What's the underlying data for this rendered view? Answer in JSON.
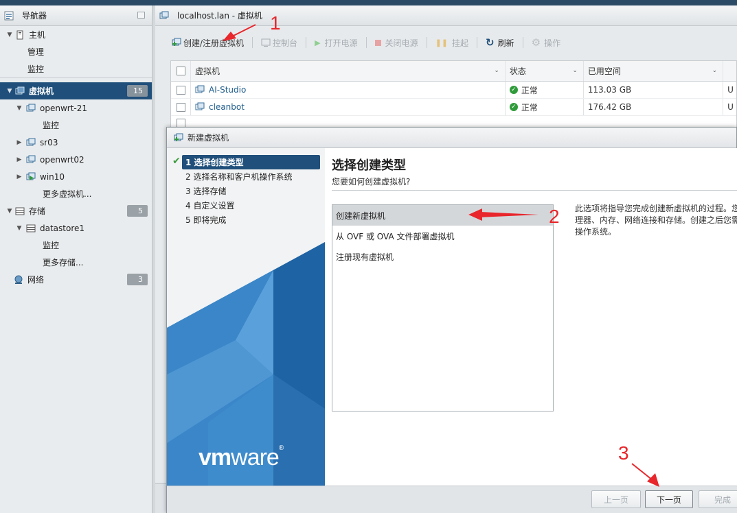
{
  "navigator": {
    "title": "导航器",
    "host": {
      "label": "主机",
      "children": [
        "管理",
        "监控"
      ]
    },
    "vms": {
      "label": "虚拟机",
      "count": "15",
      "items": [
        {
          "label": "openwrt-21",
          "child": "监控"
        },
        {
          "label": "sr03"
        },
        {
          "label": "openwrt02"
        },
        {
          "label": "win10"
        }
      ],
      "more": "更多虚拟机..."
    },
    "storage": {
      "label": "存储",
      "count": "5",
      "datastore": "datastore1",
      "monitor": "监控",
      "more": "更多存储..."
    },
    "network": {
      "label": "网络",
      "count": "3"
    }
  },
  "main": {
    "title": "localhost.lan - 虚拟机",
    "toolbar": {
      "create": "创建/注册虚拟机",
      "console": "控制台",
      "power_on": "打开电源",
      "power_off": "关闭电源",
      "suspend": "挂起",
      "refresh": "刷新",
      "actions": "操作"
    },
    "grid": {
      "columns": [
        "虚拟机",
        "状态",
        "已用空间"
      ],
      "rows": [
        {
          "name": "AI-Studio",
          "status": "正常",
          "used": "113.03 GB",
          "extra": "U"
        },
        {
          "name": "cleanbot",
          "status": "正常",
          "used": "176.42 GB",
          "extra": "U"
        }
      ]
    }
  },
  "dialog": {
    "title": "新建虚拟机",
    "steps": [
      "1 选择创建类型",
      "2 选择名称和客户机操作系统",
      "3 选择存储",
      "4 自定义设置",
      "5 即将完成"
    ],
    "heading": "选择创建类型",
    "subheading": "您要如何创建虚拟机?",
    "options": [
      "创建新虚拟机",
      "从 OVF 或 OVA 文件部署虚拟机",
      "注册现有虚拟机"
    ],
    "description": [
      "此选项将指导您完成创建新虚拟机的过程。您",
      "理器、内存、网络连接和存储。创建之后您需",
      "操作系统。"
    ],
    "logo": {
      "vm": "vm",
      "ware": "ware"
    },
    "buttons": {
      "back": "上一页",
      "next": "下一页",
      "finish": "完成"
    }
  },
  "annotations": [
    "1",
    "2",
    "3"
  ],
  "colors": {
    "accent": "#1f4f7a",
    "annotation": "#e8262b",
    "ok": "#2f9b3a"
  }
}
